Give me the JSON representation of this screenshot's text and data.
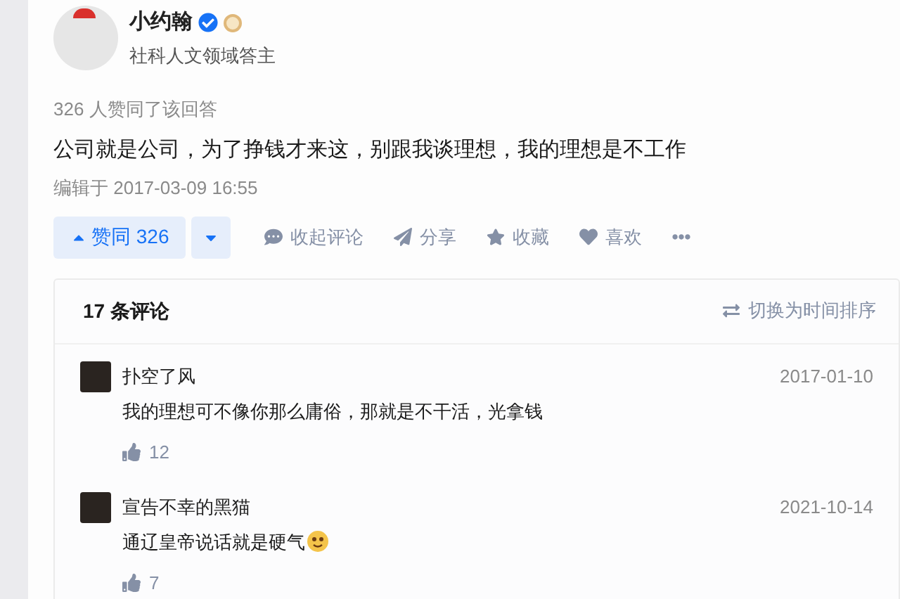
{
  "author": {
    "name": "小约翰",
    "title": "社科人文领域答主"
  },
  "vote_summary": "326 人赞同了该回答",
  "answer_text": "公司就是公司，为了挣钱才来这，别跟我谈理想，我的理想是不工作",
  "edited": "编辑于 2017-03-09 16:55",
  "upvote": {
    "label": "赞同 326"
  },
  "actions": [
    {
      "kind": "comment",
      "label": "收起评论"
    },
    {
      "kind": "share",
      "label": "分享"
    },
    {
      "kind": "star",
      "label": "收藏"
    },
    {
      "kind": "heart",
      "label": "喜欢"
    }
  ],
  "comments_header": {
    "count": "17 条评论",
    "sort": "切换为时间排序"
  },
  "comments": [
    {
      "user": "扑空了风",
      "date": "2017-01-10",
      "text": "我的理想可不像你那么庸俗，那就是不干活，光拿钱",
      "emoji": false,
      "likes": "12"
    },
    {
      "user": "宣告不幸的黑猫",
      "date": "2021-10-14",
      "text": "通辽皇帝说话就是硬气",
      "emoji": true,
      "likes": "7"
    }
  ]
}
